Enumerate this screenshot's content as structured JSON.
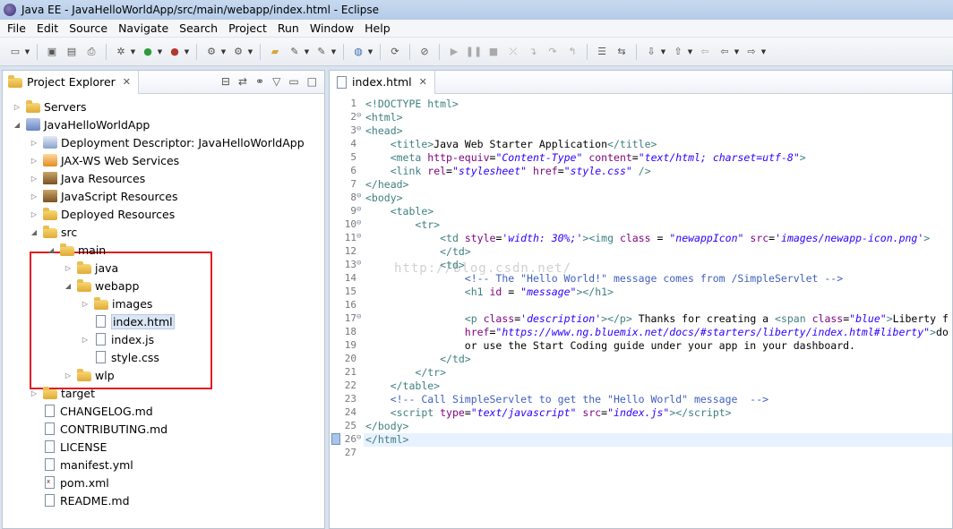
{
  "window": {
    "title": "Java EE - JavaHelloWorldApp/src/main/webapp/index.html - Eclipse"
  },
  "menu": [
    "File",
    "Edit",
    "Source",
    "Navigate",
    "Search",
    "Project",
    "Run",
    "Window",
    "Help"
  ],
  "project_explorer": {
    "tab_label": "Project Explorer",
    "tree": [
      {
        "label": "Servers",
        "icon": "folder",
        "indent": 0,
        "twisty": "collapsed"
      },
      {
        "label": "JavaHelloWorldApp",
        "icon": "project",
        "indent": 0,
        "twisty": "expanded"
      },
      {
        "label": "Deployment Descriptor: JavaHelloWorldApp",
        "icon": "descriptor",
        "indent": 1,
        "twisty": "collapsed"
      },
      {
        "label": "JAX-WS Web Services",
        "icon": "ws",
        "indent": 1,
        "twisty": "collapsed"
      },
      {
        "label": "Java Resources",
        "icon": "jar",
        "indent": 1,
        "twisty": "collapsed"
      },
      {
        "label": "JavaScript Resources",
        "icon": "jar",
        "indent": 1,
        "twisty": "collapsed"
      },
      {
        "label": "Deployed Resources",
        "icon": "folder",
        "indent": 1,
        "twisty": "collapsed"
      },
      {
        "label": "src",
        "icon": "folder",
        "indent": 1,
        "twisty": "expanded"
      },
      {
        "label": "main",
        "icon": "folder",
        "indent": 2,
        "twisty": "expanded"
      },
      {
        "label": "java",
        "icon": "folder",
        "indent": 3,
        "twisty": "collapsed"
      },
      {
        "label": "webapp",
        "icon": "folder",
        "indent": 3,
        "twisty": "expanded"
      },
      {
        "label": "images",
        "icon": "folder",
        "indent": 4,
        "twisty": "collapsed"
      },
      {
        "label": "index.html",
        "icon": "file",
        "indent": 4,
        "twisty": "none",
        "selected": true
      },
      {
        "label": "index.js",
        "icon": "file",
        "indent": 4,
        "twisty": "collapsed"
      },
      {
        "label": "style.css",
        "icon": "file",
        "indent": 4,
        "twisty": "none"
      },
      {
        "label": "wlp",
        "icon": "folder",
        "indent": 3,
        "twisty": "collapsed"
      },
      {
        "label": "target",
        "icon": "folder",
        "indent": 1,
        "twisty": "collapsed"
      },
      {
        "label": "CHANGELOG.md",
        "icon": "file",
        "indent": 1,
        "twisty": "none"
      },
      {
        "label": "CONTRIBUTING.md",
        "icon": "file",
        "indent": 1,
        "twisty": "none"
      },
      {
        "label": "LICENSE",
        "icon": "file",
        "indent": 1,
        "twisty": "none"
      },
      {
        "label": "manifest.yml",
        "icon": "file",
        "indent": 1,
        "twisty": "none"
      },
      {
        "label": "pom.xml",
        "icon": "xml",
        "indent": 1,
        "twisty": "none"
      },
      {
        "label": "README.md",
        "icon": "file",
        "indent": 1,
        "twisty": "none"
      }
    ]
  },
  "editor": {
    "tab_label": "index.html",
    "watermark": "http://blog.csdn.net/",
    "lines": [
      {
        "n": "1",
        "fold": "",
        "html": "<span class=\"tag\">&lt;!DOCTYPE html&gt;</span>"
      },
      {
        "n": "2",
        "fold": "⊖",
        "html": "<span class=\"tag\">&lt;html&gt;</span>"
      },
      {
        "n": "3",
        "fold": "⊖",
        "html": "<span class=\"tag\">&lt;head&gt;</span>"
      },
      {
        "n": "4",
        "fold": "",
        "html": "    <span class=\"tag\">&lt;title&gt;</span>Java Web Starter Application<span class=\"tag\">&lt;/title&gt;</span>"
      },
      {
        "n": "5",
        "fold": "",
        "html": "    <span class=\"tag\">&lt;meta</span> <span class=\"attr\">http-equiv</span>=<span class=\"val\">\"Content-Type\"</span> <span class=\"attr\">content</span>=<span class=\"val\">\"text/html; charset=utf-8\"</span><span class=\"tag\">&gt;</span>"
      },
      {
        "n": "6",
        "fold": "",
        "html": "    <span class=\"tag\">&lt;link</span> <span class=\"attr\">rel</span>=<span class=\"val\">\"stylesheet\"</span> <span class=\"attr\">href</span>=<span class=\"val\">\"style.css\"</span> <span class=\"tag\">/&gt;</span>"
      },
      {
        "n": "7",
        "fold": "",
        "html": "<span class=\"tag\">&lt;/head&gt;</span>"
      },
      {
        "n": "8",
        "fold": "⊖",
        "html": "<span class=\"tag\">&lt;body&gt;</span>"
      },
      {
        "n": "9",
        "fold": "⊖",
        "html": "    <span class=\"tag\">&lt;table&gt;</span>"
      },
      {
        "n": "10",
        "fold": "⊖",
        "html": "        <span class=\"tag\">&lt;tr&gt;</span>"
      },
      {
        "n": "11",
        "fold": "⊖",
        "html": "            <span class=\"tag\">&lt;td</span> <span class=\"attr\">style</span>=<span class=\"val\">'width: 30%;'</span><span class=\"tag\">&gt;&lt;img</span> <span class=\"attr\">class</span> = <span class=\"val\">\"newappIcon\"</span> <span class=\"attr\">src</span>=<span class=\"val\">'images/newapp-icon.png'</span><span class=\"tag\">&gt;</span>"
      },
      {
        "n": "12",
        "fold": "",
        "html": "            <span class=\"tag\">&lt;/td&gt;</span>"
      },
      {
        "n": "13",
        "fold": "⊖",
        "html": "            <span class=\"tag\">&lt;td&gt;</span>"
      },
      {
        "n": "14",
        "fold": "",
        "html": "                <span class=\"cmt\">&lt;!-- The \"Hello World!\" message comes from /SimpleServlet --&gt;</span>"
      },
      {
        "n": "15",
        "fold": "",
        "html": "                <span class=\"tag\">&lt;h1</span> <span class=\"attr\">id</span> = <span class=\"val\">\"message\"</span><span class=\"tag\">&gt;&lt;/h1&gt;</span>"
      },
      {
        "n": "16",
        "fold": "",
        "html": ""
      },
      {
        "n": "17",
        "fold": "⊖",
        "html": "                <span class=\"tag\">&lt;p</span> <span class=\"attr\">class</span>=<span class=\"val\">'description'</span><span class=\"tag\">&gt;&lt;/p&gt;</span> Thanks for creating a <span class=\"tag\">&lt;span</span> <span class=\"attr\">class</span>=<span class=\"val\">\"blue\"</span><span class=\"tag\">&gt;</span>Liberty f"
      },
      {
        "n": "18",
        "fold": "",
        "html": "                <span class=\"attr\">href</span>=<span class=\"val\">\"https://www.ng.bluemix.net/docs/#starters/liberty/index.html#liberty\"</span><span class=\"tag\">&gt;</span>do"
      },
      {
        "n": "19",
        "fold": "",
        "html": "                or use the Start Coding guide under your app in your dashboard."
      },
      {
        "n": "20",
        "fold": "",
        "html": "            <span class=\"tag\">&lt;/td&gt;</span>"
      },
      {
        "n": "21",
        "fold": "",
        "html": "        <span class=\"tag\">&lt;/tr&gt;</span>"
      },
      {
        "n": "22",
        "fold": "",
        "html": "    <span class=\"tag\">&lt;/table&gt;</span>"
      },
      {
        "n": "23",
        "fold": "",
        "html": "    <span class=\"cmt\">&lt;!-- Call SimpleServlet to get the \"Hello World\" message  --&gt;</span>"
      },
      {
        "n": "24",
        "fold": "",
        "html": "    <span class=\"tag\">&lt;script</span> <span class=\"attr\">type</span>=<span class=\"val\">\"text/javascript\"</span> <span class=\"attr\">src</span>=<span class=\"val\">\"index.js\"</span><span class=\"tag\">&gt;&lt;/script&gt;</span>"
      },
      {
        "n": "25",
        "fold": "",
        "html": "<span class=\"tag\">&lt;/body&gt;</span>"
      },
      {
        "n": "26",
        "fold": "⊖",
        "html": "<span class=\"tag\">&lt;/html&gt;</span>",
        "current": true
      },
      {
        "n": "27",
        "fold": "",
        "html": ""
      }
    ]
  }
}
